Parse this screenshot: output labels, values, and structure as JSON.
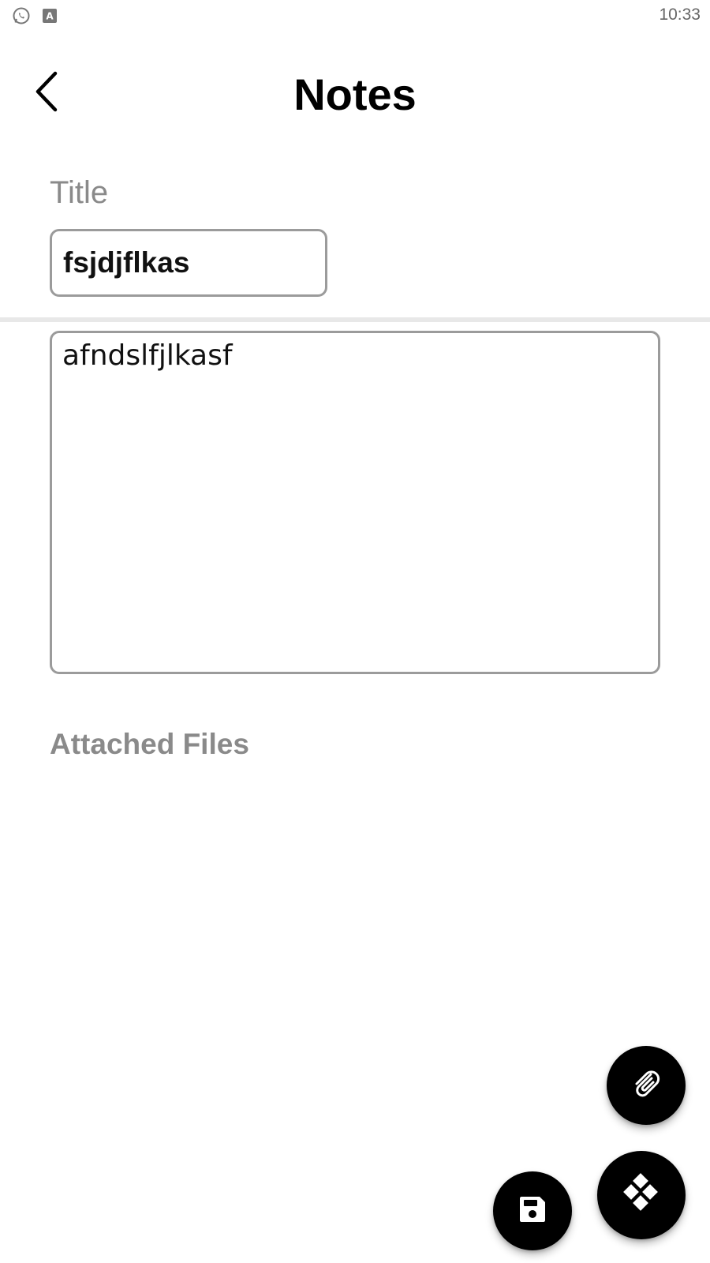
{
  "status_bar": {
    "time": "10:33",
    "icons": [
      "whatsapp-icon",
      "app-a-icon"
    ]
  },
  "header": {
    "back_icon": "chevron-left-icon",
    "title": "Notes"
  },
  "note": {
    "title_label": "Title",
    "title_value": "fsjdjflkas",
    "body_value": "afndslfjlkasf"
  },
  "attachments": {
    "label": "Attached Files"
  },
  "fabs": {
    "attach_icon": "paperclip-icon",
    "save_icon": "save-icon",
    "main_icon": "diamond-grid-icon"
  },
  "colors": {
    "fab_background": "#000000",
    "label_gray": "#8a8a8a",
    "border_gray": "#9b9b9b",
    "divider": "#e8e8e8"
  }
}
